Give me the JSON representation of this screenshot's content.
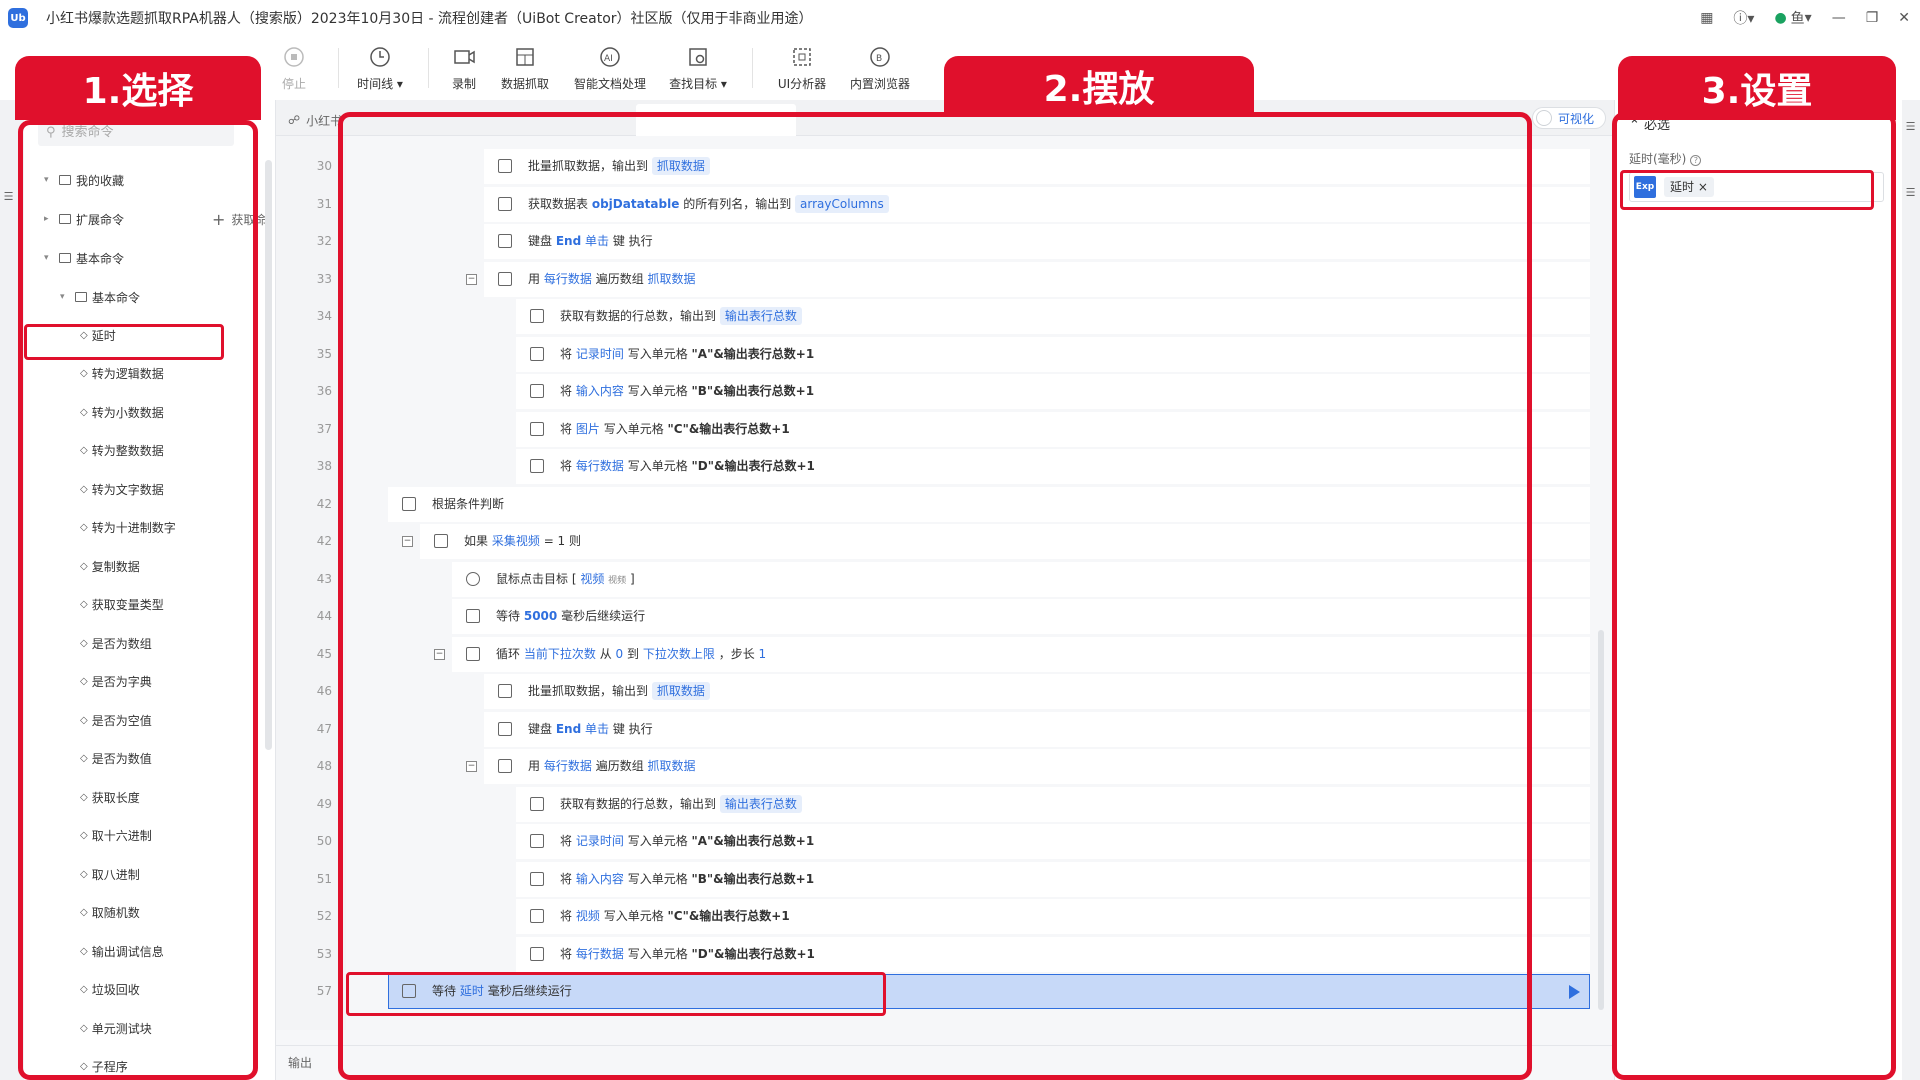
{
  "window": {
    "title": "小红书爆款选题抓取RPA机器人（搜索版）2023年10月30日 - 流程创建者（UiBot Creator）社区版（仅用于非商业用途）",
    "logo": "Ub",
    "user_name": "鱼"
  },
  "toolbar": {
    "stop": "停止",
    "timeline": "时间线",
    "record": "录制",
    "data_scrape": "数据抓取",
    "smart_doc": "智能文档处理",
    "find_target": "查找目标",
    "ui_analyzer": "UI分析器",
    "builtin_browser": "内置浏览器"
  },
  "annotations": {
    "select_label": "1.选择",
    "place_label": "2.摆放",
    "settings_label": "3.设置"
  },
  "sidebar": {
    "search_placeholder": "搜索命令",
    "favorites": "我的收藏",
    "extensions": "扩展命令",
    "get_more": "获取命",
    "basic_root": "基本命令",
    "basic_group": "基本命令",
    "commands": [
      "延时",
      "转为逻辑数据",
      "转为小数数据",
      "转为整数数据",
      "转为文字数据",
      "转为十进制数字",
      "复制数据",
      "获取变量类型",
      "是否为数组",
      "是否为字典",
      "是否为空值",
      "是否为数值",
      "获取长度",
      "取十六进制",
      "取八进制",
      "取随机数",
      "输出调试信息",
      "垃圾回收",
      "单元测试块",
      "子程序"
    ]
  },
  "editor": {
    "breadcrumb_tab": "小红书",
    "active_tab": "",
    "visualize": "可视化",
    "output_label": "输出",
    "lines": {
      "l30": {
        "num": "30",
        "t1": "批量抓取数据，输出到",
        "v1": "抓取数据"
      },
      "l31": {
        "num": "31",
        "t1": "获取数据表",
        "v1": "objDatatable",
        "t2": "的所有列名，输出到",
        "v2": "arrayColumns"
      },
      "l32": {
        "num": "32",
        "t1": "键盘",
        "k": "End",
        "t2": "键 执行",
        "v1": "单击"
      },
      "l33": {
        "num": "33",
        "t1": "用",
        "v1": "每行数据",
        "t2": "遍历数组",
        "v2": "抓取数据"
      },
      "l34": {
        "num": "34",
        "t1": "获取有数据的行总数，输出到",
        "v1": "输出表行总数"
      },
      "l35": {
        "num": "35",
        "t1": "将",
        "v1": "记录时间",
        "t2": "写入单元格",
        "v2": "\"A\"&输出表行总数+1"
      },
      "l36": {
        "num": "36",
        "t1": "将",
        "v1": "输入内容",
        "t2": "写入单元格",
        "v2": "\"B\"&输出表行总数+1"
      },
      "l37": {
        "num": "37",
        "t1": "将",
        "v1": "图片",
        "t2": "写入单元格",
        "v2": "\"C\"&输出表行总数+1"
      },
      "l38": {
        "num": "38",
        "t1": "将",
        "v1": "每行数据",
        "t2": "写入单元格",
        "v2": "\"D\"&输出表行总数+1"
      },
      "l42a": {
        "num": "42",
        "t1": "根据条件判断"
      },
      "l42b": {
        "num": "42",
        "t1": "如果",
        "v1": "采集视频",
        "t2": "= 1 则"
      },
      "l43": {
        "num": "43",
        "t1": "鼠标点击目标 [",
        "v1": "视频",
        "small": "视频",
        "t2": "]"
      },
      "l44": {
        "num": "44",
        "t1": "等待",
        "v1": "5000",
        "t2": "毫秒后继续运行"
      },
      "l45": {
        "num": "45",
        "t1": "循环",
        "v1": "当前下拉次数",
        "t2": "从",
        "v2": "0",
        "t3": "到",
        "v3": "下拉次数上限",
        "t4": "，步长",
        "v4": "1"
      },
      "l46": {
        "num": "46",
        "t1": "批量抓取数据，输出到",
        "v1": "抓取数据"
      },
      "l47": {
        "num": "47",
        "t1": "键盘",
        "k": "End",
        "t2": "键 执行",
        "v1": "单击"
      },
      "l48": {
        "num": "48",
        "t1": "用",
        "v1": "每行数据",
        "t2": "遍历数组",
        "v2": "抓取数据"
      },
      "l49": {
        "num": "49",
        "t1": "获取有数据的行总数，输出到",
        "v1": "输出表行总数"
      },
      "l50": {
        "num": "50",
        "t1": "将",
        "v1": "记录时间",
        "t2": "写入单元格",
        "v2": "\"A\"&输出表行总数+1"
      },
      "l51": {
        "num": "51",
        "t1": "将",
        "v1": "输入内容",
        "t2": "写入单元格",
        "v2": "\"B\"&输出表行总数+1"
      },
      "l52": {
        "num": "52",
        "t1": "将",
        "v1": "视频",
        "t2": "写入单元格",
        "v2": "\"C\"&输出表行总数+1"
      },
      "l53": {
        "num": "53",
        "t1": "将",
        "v1": "每行数据",
        "t2": "写入单元格",
        "v2": "\"D\"&输出表行总数+1"
      },
      "l57": {
        "num": "57",
        "t1": "等待",
        "v1": "延时",
        "t2": "毫秒后继续运行"
      }
    }
  },
  "properties": {
    "section": "必选",
    "delay_label": "延时(毫秒)",
    "exp_badge": "Exp",
    "delay_value": "延时",
    "remove": "×"
  },
  "colors": {
    "accent": "#2f6fde",
    "highlight": "#e0102c",
    "selected_row": "#c7d9f8"
  }
}
